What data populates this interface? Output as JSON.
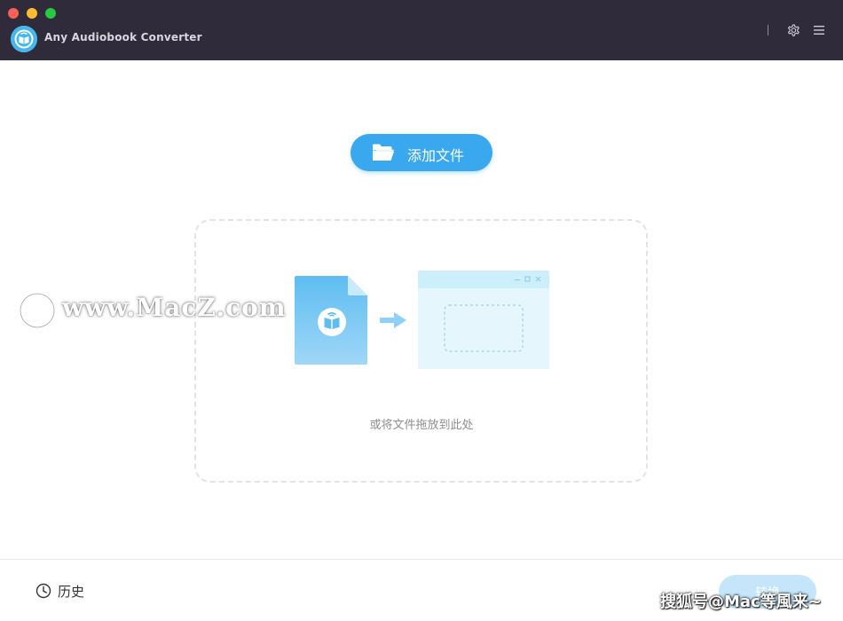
{
  "window": {
    "title": "Any Audiobook Converter"
  },
  "icons": {
    "app_logo": "audiobook-logo-icon",
    "settings": "gear-icon",
    "menu": "hamburger-menu-icon",
    "folder": "folder-open-icon",
    "file": "audiobook-file-icon",
    "arrow": "arrow-right-icon",
    "app_window": "app-window-icon",
    "history": "clock-icon"
  },
  "main": {
    "add_button_label": "添加文件",
    "drop_hint": "或将文件拖放到此处"
  },
  "footer": {
    "history_label": "历史",
    "convert_label": "转换"
  },
  "watermarks": {
    "site": "www.MacZ.com",
    "source": "搜狐号@Mac等風来~"
  },
  "colors": {
    "titlebar": "#2f2b3b",
    "accent": "#3aa8ef",
    "convert_disabled": "#c5e6fa"
  }
}
